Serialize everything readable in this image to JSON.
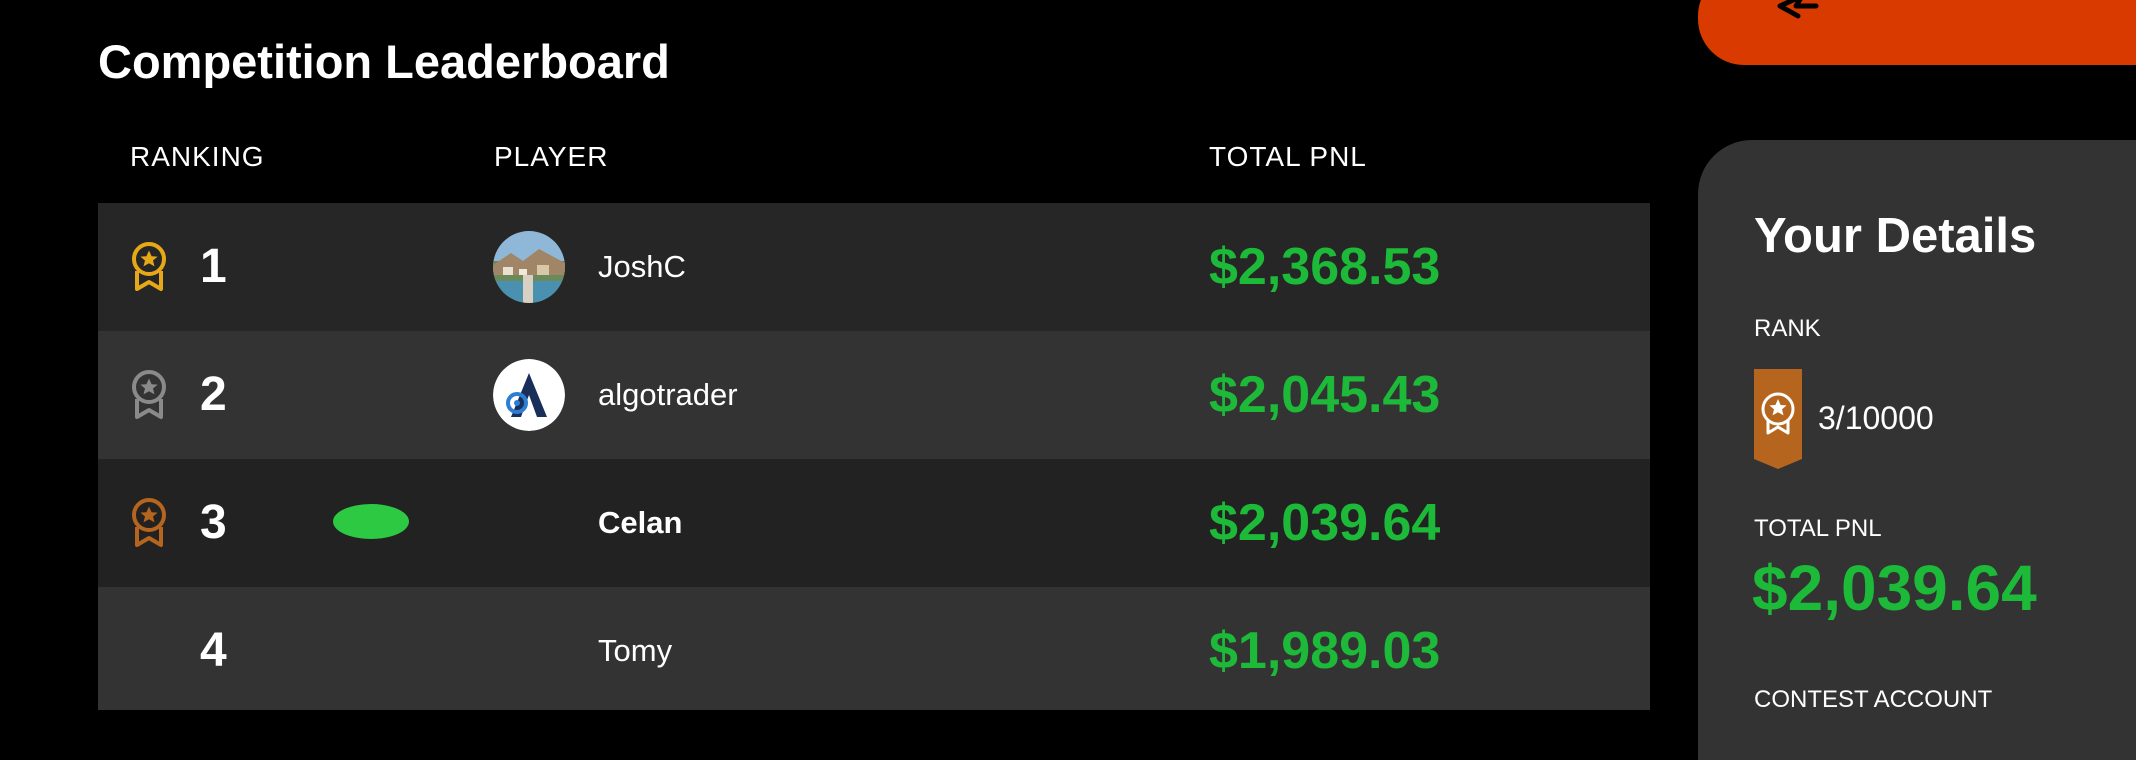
{
  "leaderboard": {
    "title": "Competition Leaderboard",
    "columns": {
      "ranking": "RANKING",
      "player": "PLAYER",
      "total_pnl": "TOTAL PNL"
    },
    "rows": [
      {
        "rank": "1",
        "medal": "gold-medal-icon",
        "avatar": "landscape-photo-avatar",
        "player": "JoshC",
        "pnl": "$2,368.53",
        "bg": "#262626"
      },
      {
        "rank": "2",
        "medal": "silver-medal-icon",
        "avatar": "algotrader-logo-avatar",
        "player": "algotrader",
        "pnl": "$2,045.43",
        "bg": "#333333"
      },
      {
        "rank": "3",
        "medal": "bronze-medal-icon",
        "avatar": "",
        "player": "Celan",
        "pnl": "$2,039.64",
        "bg": "#222222"
      },
      {
        "rank": "4",
        "medal": "",
        "avatar": "",
        "player": "Tomy",
        "pnl": "$1,989.03",
        "bg": "#333333"
      }
    ]
  },
  "details": {
    "title": "Your Details",
    "rank_label": "RANK",
    "rank_value": "3/10000",
    "total_pnl_label": "TOTAL PNL",
    "total_pnl": "$2,039.64",
    "contest_account_label": "CONTEST ACCOUNT"
  },
  "colors": {
    "pnl_green": "#1db939",
    "orange": "#d93a00",
    "gold": "#e6a817",
    "silver": "#8a8a8a",
    "bronze": "#b5651d",
    "online_green": "#2dc943"
  }
}
